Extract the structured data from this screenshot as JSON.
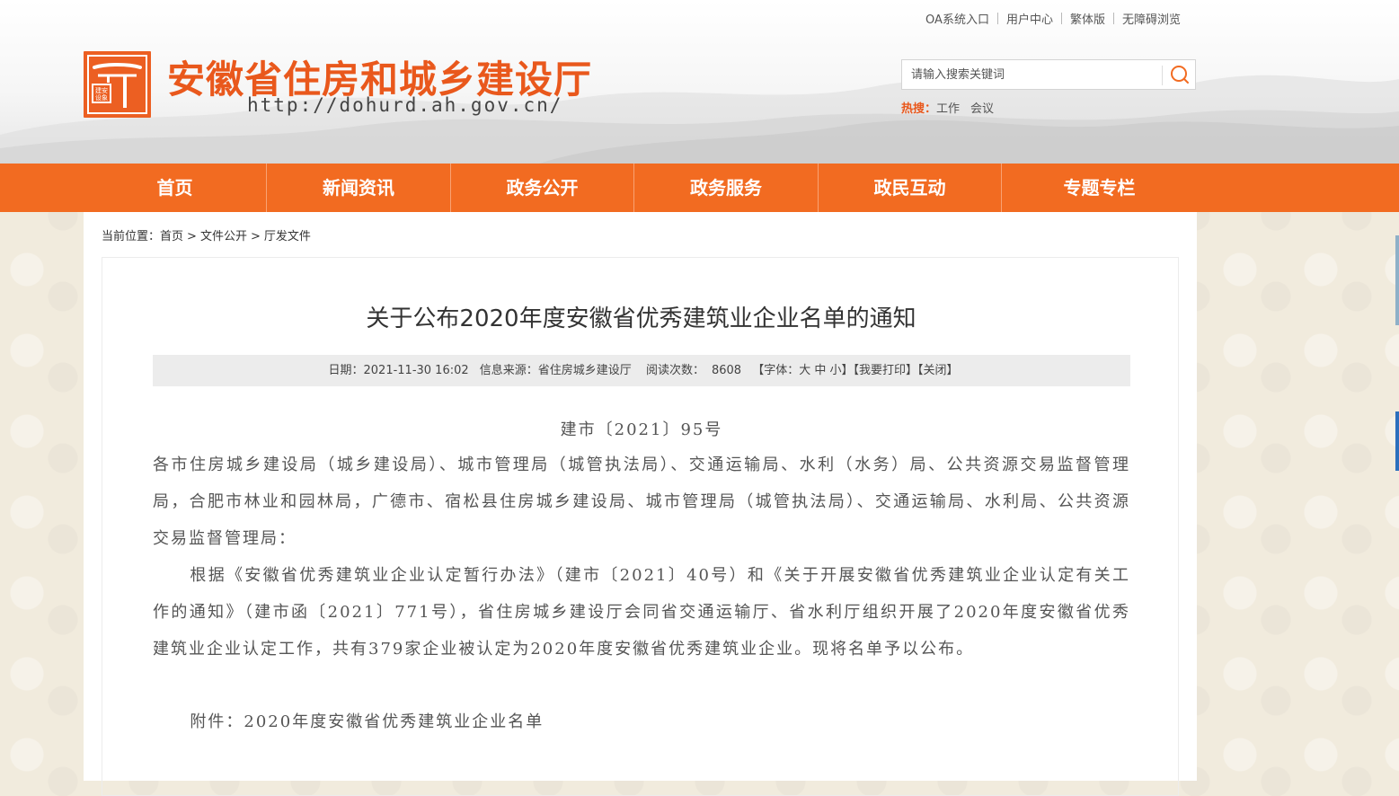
{
  "toplinks": [
    "OA系统入口",
    "用户中心",
    "繁体版",
    "无障碍浏览"
  ],
  "site": {
    "title": "安徽省住房和城乡建设厅",
    "url": "http://dohurd.ah.gov.cn/",
    "logo_seal_text": "建安设象"
  },
  "search": {
    "placeholder": "请输入搜索关键词",
    "hot_label": "热搜：",
    "hot_items": [
      "工作",
      "会议"
    ]
  },
  "nav": [
    "首页",
    "新闻资讯",
    "政务公开",
    "政务服务",
    "政民互动",
    "专题专栏"
  ],
  "breadcrumb": {
    "prefix": "当前位置：",
    "items": [
      "首页",
      "文件公开",
      "厅发文件"
    ],
    "separator": ">"
  },
  "article": {
    "title": "关于公布2020年度安徽省优秀建筑业企业名单的通知",
    "meta": {
      "date": "日期：2021-11-30 16:02",
      "source": "信息来源：省住房城乡建设厅",
      "reads_label": "阅读次数：",
      "reads": "8608",
      "font_size": "【字体：大 中 小】",
      "print": "【我要打印】",
      "close": "【关闭】"
    },
    "doc_no": "建市〔2021〕95号",
    "addressees": "各市住房城乡建设局（城乡建设局）、城市管理局（城管执法局）、交通运输局、水利（水务）局、公共资源交易监督管理局，合肥市林业和园林局，广德市、宿松县住房城乡建设局、城市管理局（城管执法局）、交通运输局、水利局、公共资源交易监督管理局：",
    "paragraph": "根据《安徽省优秀建筑业企业认定暂行办法》（建市〔2021〕40号）和《关于开展安徽省优秀建筑业企业认定有关工作的通知》（建市函〔2021〕771号），省住房城乡建设厅会同省交通运输厅、省水利厅组织开展了2020年度安徽省优秀建筑业企业认定工作，共有379家企业被认定为2020年度安徽省优秀建筑业企业。现将名单予以公布。",
    "attachment": "附件：2020年度安徽省优秀建筑业企业名单"
  },
  "colors": {
    "brand_orange": "#f26b21",
    "title_orange": "#e9581c"
  }
}
